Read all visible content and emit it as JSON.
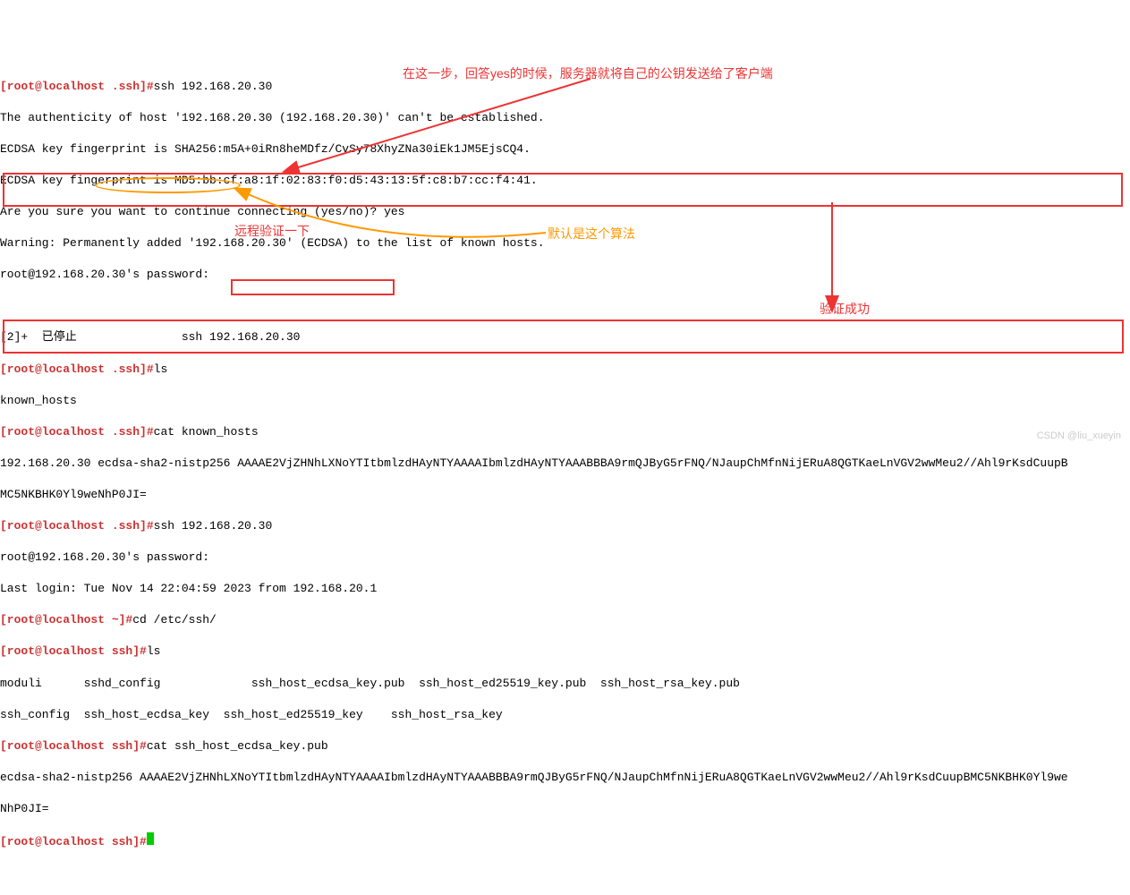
{
  "lines": {
    "l1_prompt": "[root@localhost .ssh]#",
    "l1_cmd": "ssh 192.168.20.30",
    "l2": "The authenticity of host '192.168.20.30 (192.168.20.30)' can't be established.",
    "l3": "ECDSA key fingerprint is SHA256:m5A+0iRn8heMDfz/CvSy78XhyZNa30iEk1JM5EjsCQ4.",
    "l4": "ECDSA key fingerprint is MD5:bb:cf:a8:1f:02:83:f0:d5:43:13:5f:c8:b7:cc:f4:41.",
    "l5": "Are you sure you want to continue connecting (yes/no)? yes",
    "l6": "Warning: Permanently added '192.168.20.30' (ECDSA) to the list of known hosts.",
    "l7": "root@192.168.20.30's password:",
    "l8": " ",
    "l9": "[2]+  已停止               ssh 192.168.20.30",
    "l10_prompt": "[root@localhost .ssh]#",
    "l10_cmd": "ls",
    "l11": "known_hosts",
    "l12_prompt": "[root@localhost .ssh]#",
    "l12_cmd": "cat known_hosts",
    "l13": "192.168.20.30 ecdsa-sha2-nistp256 AAAAE2VjZHNhLXNoYTItbmlzdHAyNTYAAAAIbmlzdHAyNTYAAABBBA9rmQJByG5rFNQ/NJaupChMfnNijERuA8QGTKaeLnVGV2wwMeu2//Ahl9rKsdCuupB",
    "l14": "MC5NKBHK0Yl9weNhP0JI=",
    "l15_prompt": "[root@localhost .ssh]#",
    "l15_cmd": "ssh 192.168.20.30",
    "l16": "root@192.168.20.30's password: ",
    "l17": "Last login: Tue Nov 14 22:04:59 2023 from 192.168.20.1",
    "l18_prompt": "[root@localhost ~]#",
    "l18_cmd": "cd /etc/ssh/",
    "l19_prompt": "[root@localhost ssh]#",
    "l19_cmd": "ls",
    "l20": "moduli      sshd_config             ssh_host_ecdsa_key.pub  ssh_host_ed25519_key.pub  ssh_host_rsa_key.pub",
    "l21": "ssh_config  ssh_host_ecdsa_key  ssh_host_ed25519_key    ssh_host_rsa_key",
    "l22_prompt": "[root@localhost ssh]#",
    "l22_cmd": "cat ssh_host_ecdsa_key.pub",
    "l23": "ecdsa-sha2-nistp256 AAAAE2VjZHNhLXNoYTItbmlzdHAyNTYAAAAIbmlzdHAyNTYAAABBBA9rmQJByG5rFNQ/NJaupChMfnNijERuA8QGTKaeLnVGV2wwMeu2//Ahl9rKsdCuupBMC5NKBHK0Yl9we",
    "l24": "NhP0JI=",
    "l25_prompt": "[root@localhost ssh]#"
  },
  "annotations": {
    "note1": "在这一步，回答yes的时候，服务器就将自己的公钥发送给了客户端",
    "note2": "远程验证一下",
    "note3": "默认是这个算法",
    "note4": "验证成功"
  },
  "watermark": "CSDN @liu_xueyin"
}
